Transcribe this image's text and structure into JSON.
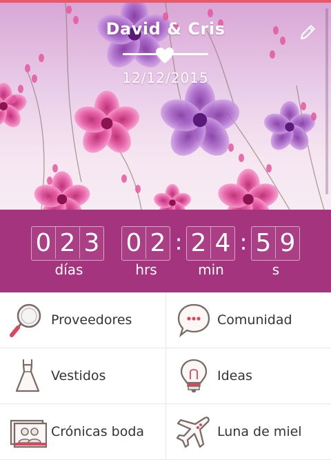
{
  "header": {
    "couple": "David & Cris",
    "date": "12/12/2015"
  },
  "countdown": {
    "days": {
      "digits": [
        "0",
        "2",
        "3"
      ],
      "label": "días"
    },
    "hours": {
      "digits": [
        "0",
        "2"
      ],
      "label": "hrs"
    },
    "minutes": {
      "digits": [
        "2",
        "4"
      ],
      "label": "min"
    },
    "seconds": {
      "digits": [
        "5",
        "9"
      ],
      "label": "s"
    },
    "separator": ":"
  },
  "menu": [
    {
      "label": "Proveedores",
      "icon": "magnifier-icon"
    },
    {
      "label": "Comunidad",
      "icon": "chat-bubble-icon"
    },
    {
      "label": "Vestidos",
      "icon": "dress-icon"
    },
    {
      "label": "Ideas",
      "icon": "lightbulb-icon"
    },
    {
      "label": "Crónicas boda",
      "icon": "photo-album-icon"
    },
    {
      "label": "Luna de miel",
      "icon": "airplane-icon"
    }
  ],
  "colors": {
    "accent": "#a5347e",
    "top_line": "#e85a6a",
    "header_bg": "#ead0ea",
    "icon_red": "#d8485c"
  }
}
